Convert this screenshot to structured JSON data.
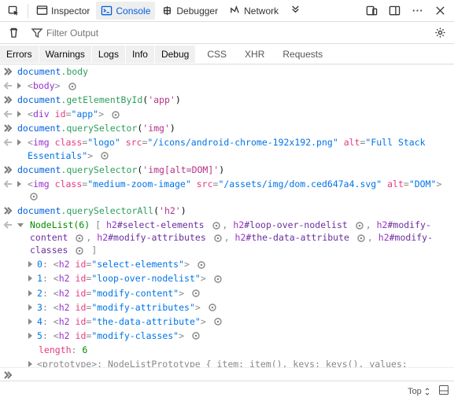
{
  "toolbar": {
    "inspector": "Inspector",
    "console": "Console",
    "debugger": "Debugger",
    "network": "Network"
  },
  "filter": {
    "placeholder": "Filter Output"
  },
  "filters": {
    "errors": "Errors",
    "warnings": "Warnings",
    "logs": "Logs",
    "info": "Info",
    "debug": "Debug",
    "css": "CSS",
    "xhr": "XHR",
    "requests": "Requests"
  },
  "cmd1": {
    "o": "document",
    "p": ".body"
  },
  "res1": {
    "tag": "body"
  },
  "cmd2": {
    "o": "document",
    "p": ".getElementById",
    "s": "'app'"
  },
  "res2": {
    "tag": "div",
    "id_attr": "id",
    "eq": "=",
    "id_val": "\"app\""
  },
  "cmd3": {
    "o": "document",
    "p": ".querySelector",
    "s": "'img'"
  },
  "res3": {
    "tag": "img",
    "cls_a": "class",
    "eq": "=",
    "cls_v": "\"logo\"",
    "src_a": "src",
    "src_v": "\"/icons/android-chrome-192x192.png\"",
    "alt_a": "alt",
    "alt_v": "\"Full Stack Essentials\""
  },
  "cmd4": {
    "o": "document",
    "p": ".querySelector",
    "s": "'img[alt=DOM]'"
  },
  "res4": {
    "tag": "img",
    "cls_a": "class",
    "eq": "=",
    "cls_v": "\"medium-zoom-image\"",
    "src_a": "src",
    "src_v": "\"/assets/img/dom.ced647a4.svg\"",
    "alt_a": "alt",
    "alt_v": "\"DOM\""
  },
  "cmd5": {
    "o": "document",
    "p": ".querySelectorAll",
    "s": "'h2'"
  },
  "nl": {
    "head": "NodeList(6)",
    "open": "[ ",
    "items": [
      {
        "t": "h2",
        "sel": "#select-elements"
      },
      {
        "t": "h2",
        "sel": "#loop-over-nodelist"
      },
      {
        "t": "h2",
        "sel": "#modify-content"
      },
      {
        "t": "h2",
        "sel": "#modify-attributes"
      },
      {
        "t": "h2",
        "sel": "#the-data-attribute"
      },
      {
        "t": "h2",
        "sel": "#modify-classes"
      }
    ],
    "close": " ]",
    "rows": [
      {
        "i": "0",
        "id": "\"select-elements\""
      },
      {
        "i": "1",
        "id": "\"loop-over-nodelist\""
      },
      {
        "i": "2",
        "id": "\"modify-content\""
      },
      {
        "i": "3",
        "id": "\"modify-attributes\""
      },
      {
        "i": "4",
        "id": "\"the-data-attribute\""
      },
      {
        "i": "5",
        "id": "\"modify-classes\""
      }
    ],
    "len_k": "length",
    "len_c": ": ",
    "len_v": "6",
    "proto": "<prototype>: NodeListPrototype { item: item(), keys: keys(), values: values(), … }"
  },
  "footer": {
    "top": "Top"
  }
}
